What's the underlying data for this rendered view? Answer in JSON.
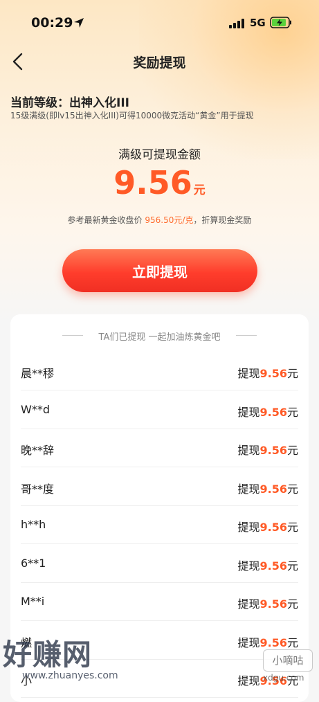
{
  "status_bar": {
    "time": "00:29",
    "network": "5G"
  },
  "nav": {
    "title": "奖励提现"
  },
  "level": {
    "text": "当前等级：出神入化III",
    "description": "15级满级(即lv15出神入化III)可得10000微克活动“黄金”用于提现"
  },
  "reward": {
    "label": "满级可提现金额",
    "amount": "9.56",
    "unit": "元",
    "ref_prefix": "参考最新黄金收盘价 ",
    "ref_price": "956.50元/克",
    "ref_suffix": "，折算现金奖励"
  },
  "button": {
    "label": "立即提现"
  },
  "list": {
    "header": "TA们已提现 一起加油炼黄金吧",
    "rows": [
      {
        "name": "晨**穋",
        "prefix": "提现",
        "value": "9.56",
        "unit": "元"
      },
      {
        "name": "W**d",
        "prefix": "提现",
        "value": "9.56",
        "unit": "元"
      },
      {
        "name": "晚**辞",
        "prefix": "提现",
        "value": "9.56",
        "unit": "元"
      },
      {
        "name": "哥**度",
        "prefix": "提现",
        "value": "9.56",
        "unit": "元"
      },
      {
        "name": "h**h",
        "prefix": "提现",
        "value": "9.56",
        "unit": "元"
      },
      {
        "name": "6**1",
        "prefix": "提现",
        "value": "9.56",
        "unit": "元"
      },
      {
        "name": "M**i",
        "prefix": "提现",
        "value": "9.56",
        "unit": "元"
      },
      {
        "name": "燃",
        "prefix": "提现",
        "value": "9.56",
        "unit": "元"
      },
      {
        "name": "小",
        "prefix": "提现",
        "value": "9.56",
        "unit": "元"
      }
    ]
  },
  "watermark": {
    "logo_text": "好赚网",
    "url": "www.zhuanyes.com",
    "badge": "小嘀咕",
    "site": "xdgu.com"
  },
  "colors": {
    "accent": "#ff5a26",
    "button": "#ff3d2c",
    "background_top": "#fde7c4"
  }
}
